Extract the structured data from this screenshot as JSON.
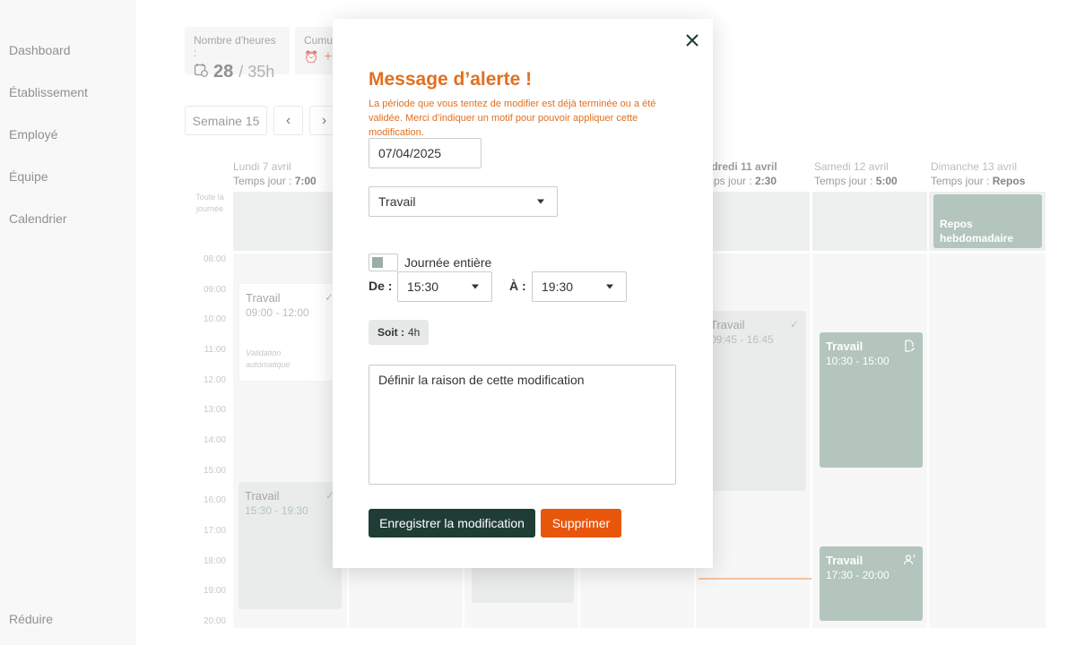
{
  "sidebar": {
    "items": [
      {
        "label": "Dashboard"
      },
      {
        "label": "Établissement"
      },
      {
        "label": "Employé"
      },
      {
        "label": "Équipe"
      },
      {
        "label": "Calendrier"
      }
    ],
    "collapse_label": "Réduire"
  },
  "stats": {
    "hours_label": "Nombre d'heures :",
    "hours_done": "28",
    "hours_total": "/ 35h",
    "cumul_label": "Cumu",
    "cumul_value": "+"
  },
  "week": {
    "label": "Semaine 15",
    "prev": "‹",
    "next": "›"
  },
  "days": [
    {
      "name": "Lundi 7 avril",
      "time_label": "Temps jour : ",
      "time_value": "7:00"
    },
    {
      "name": "ndredi 11 avril",
      "time_label": "mps jour : ",
      "time_value": "2:30"
    },
    {
      "name": "Samedi 12 avril",
      "time_label": "Temps jour : ",
      "time_value": "5:00"
    },
    {
      "name": "Dimanche 13 avril",
      "time_label": "Temps jour : ",
      "time_value": "Repos"
    }
  ],
  "allday_label": "Toute la journée",
  "hours": [
    "08:00",
    "09:00",
    "10:00",
    "11:00",
    "12:00",
    "13:00",
    "14:00",
    "15:00",
    "16:00",
    "17:00",
    "18:00",
    "19:00",
    "20:00"
  ],
  "events": {
    "mon1": {
      "title": "Travail",
      "time": "09:00 - 12:00",
      "note": "Validation automatique"
    },
    "mon2": {
      "title": "Travail",
      "time": "15:30 - 19:30"
    },
    "fri1": {
      "title": "Travail",
      "time": "09:45 - 16:45"
    },
    "sat1": {
      "title": "Travail",
      "time": "10:30 - 15:00"
    },
    "sat2": {
      "title": "Travail",
      "time": "17:30 - 20:00"
    },
    "sun1": {
      "title": "Repos hebdomadaire"
    }
  },
  "modal": {
    "title": "Message d’alerte !",
    "description": "La période que vous tentez de modifier est déjà terminée ou a été validée. Merci d’indiquer un motif pour pouvoir appliquer cette modification.",
    "date": "07/04/2025",
    "type": "Travail",
    "full_day_label": "Journée entière",
    "from_label": "De :",
    "from_value": "15:30",
    "to_label": "À :",
    "to_value": "19:30",
    "soit_label": "Soit :",
    "soit_value": "4h",
    "reason_placeholder": "Définir la raison de cette modification",
    "save_label": "Enregistrer la modification",
    "delete_label": "Supprimer",
    "close_icon": "close-icon"
  },
  "colors": {
    "accent_orange": "#e07020",
    "dark_green": "#1f3d35",
    "event_green": "#8ba69a",
    "delete_orange": "#e8560c"
  }
}
